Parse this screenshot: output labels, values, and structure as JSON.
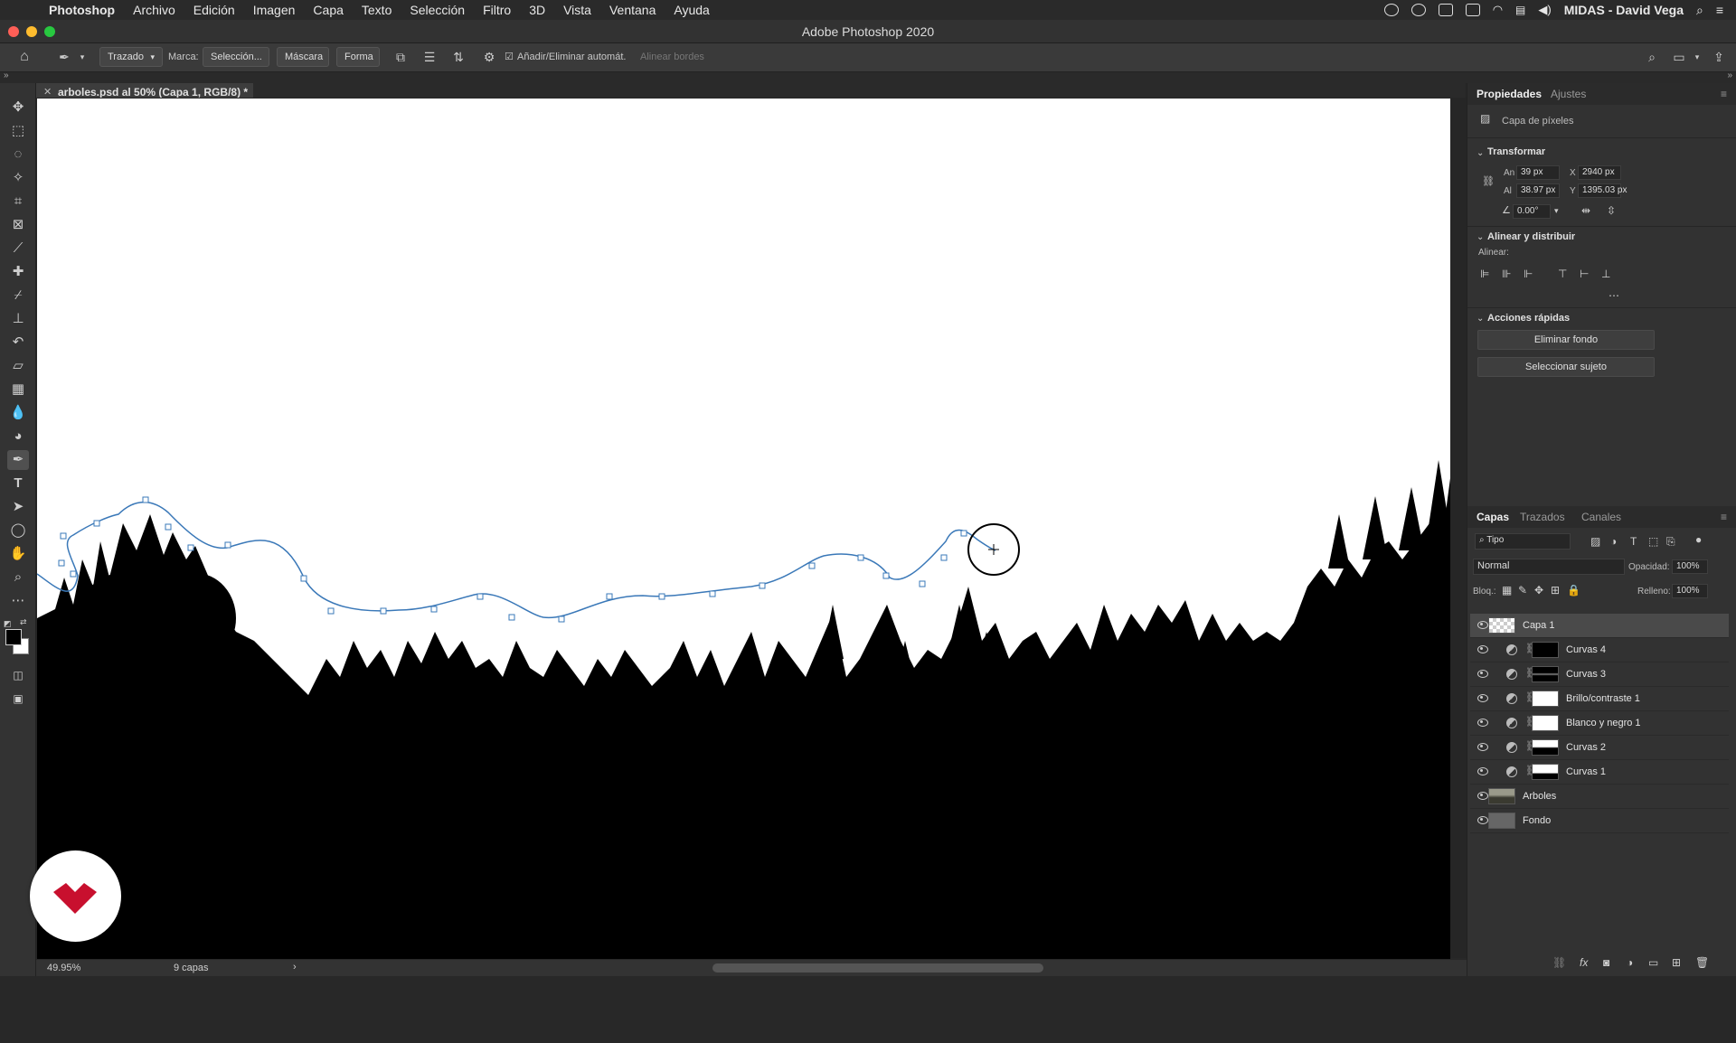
{
  "menubar": {
    "items": [
      "Photoshop",
      "Archivo",
      "Edición",
      "Imagen",
      "Capa",
      "Texto",
      "Selección",
      "Filtro",
      "3D",
      "Vista",
      "Ventana",
      "Ayuda"
    ],
    "user": "MIDAS - David Vega"
  },
  "window": {
    "title": "Adobe Photoshop 2020"
  },
  "options": {
    "mode": "Trazado",
    "marca_label": "Marca:",
    "seleccion": "Selección...",
    "mascara": "Máscara",
    "forma": "Forma",
    "auto_label": "Añadir/Eliminar automát.",
    "align_edges": "Alinear bordes"
  },
  "document": {
    "tab_label": "arboles.psd al 50% (Capa 1, RGB/8) *"
  },
  "status": {
    "zoom": "49.95%",
    "info": "9 capas"
  },
  "properties": {
    "tabs": [
      "Propiedades",
      "Ajustes"
    ],
    "layer_kind": "Capa de píxeles",
    "transform": {
      "heading": "Transformar",
      "w_label": "An",
      "w": "39 px",
      "h_label": "Al",
      "h": "38.97 px",
      "x_label": "X",
      "x": "2940 px",
      "y_label": "Y",
      "y": "1395.03 px",
      "angle": "0.00°"
    },
    "align": {
      "heading": "Alinear y distribuir",
      "label": "Alinear:"
    },
    "quick": {
      "heading": "Acciones rápidas",
      "remove_bg": "Eliminar fondo",
      "select_subject": "Seleccionar sujeto"
    }
  },
  "layers_panel": {
    "tabs": [
      "Capas",
      "Trazados",
      "Canales"
    ],
    "filter": "Tipo",
    "blend": "Normal",
    "opacity_label": "Opacidad:",
    "opacity": "100%",
    "lock_label": "Bloq.:",
    "fill_label": "Relleno:",
    "fill": "100%",
    "layers": [
      {
        "name": "Capa 1",
        "kind": "pixel",
        "selected": true
      },
      {
        "name": "Curvas 4",
        "kind": "adjustment"
      },
      {
        "name": "Curvas 3",
        "kind": "adjustment"
      },
      {
        "name": "Brillo/contraste 1",
        "kind": "adjustment"
      },
      {
        "name": "Blanco y negro 1",
        "kind": "adjustment"
      },
      {
        "name": "Curvas 2",
        "kind": "adjustment"
      },
      {
        "name": "Curvas 1",
        "kind": "adjustment"
      },
      {
        "name": "Arboles",
        "kind": "pixel"
      },
      {
        "name": "Fondo",
        "kind": "pixel"
      }
    ]
  },
  "colors": {
    "accent_path": "#3a78b8",
    "canvas_dark": "#000000"
  }
}
